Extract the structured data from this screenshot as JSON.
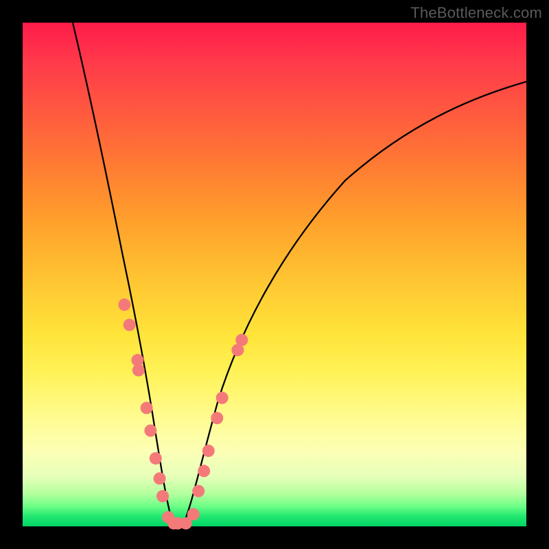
{
  "watermark": "TheBottleneck.com",
  "colors": {
    "frame": "#000000",
    "curve_stroke": "#000000",
    "marker_fill": "#f47a7a",
    "marker_stroke": "#c85a5a"
  },
  "chart_data": {
    "type": "line",
    "title": "",
    "xlabel": "",
    "ylabel": "",
    "xlim": [
      0,
      100
    ],
    "ylim": [
      0,
      100
    ],
    "grid": false,
    "legend": false,
    "curve_left": {
      "comment": "Left descending branch, starts at top-left and drops to the valley floor",
      "x": [
        10.0,
        13.5,
        17.0,
        20.5,
        24.0,
        26.5,
        28.0,
        29.5
      ],
      "y": [
        100.0,
        82.0,
        63.0,
        45.0,
        27.0,
        13.0,
        5.0,
        0.5
      ]
    },
    "curve_right": {
      "comment": "Right ascending branch, rises from valley floor toward upper-right",
      "x": [
        32.5,
        34.0,
        36.5,
        40.0,
        47.0,
        57.0,
        70.0,
        85.0,
        100.0
      ],
      "y": [
        0.5,
        3.0,
        13.0,
        27.0,
        45.0,
        61.0,
        73.0,
        82.0,
        88.0
      ]
    },
    "markers": {
      "comment": "Salmon circular data points overlaid along lower portions of both branches and valley floor",
      "points": [
        {
          "x": 20.2,
          "y": 44.0
        },
        {
          "x": 21.2,
          "y": 40.0
        },
        {
          "x": 22.8,
          "y": 33.0
        },
        {
          "x": 23.0,
          "y": 31.0
        },
        {
          "x": 24.6,
          "y": 23.5
        },
        {
          "x": 25.4,
          "y": 19.0
        },
        {
          "x": 26.4,
          "y": 13.5
        },
        {
          "x": 27.2,
          "y": 9.5
        },
        {
          "x": 27.8,
          "y": 6.0
        },
        {
          "x": 28.9,
          "y": 1.8
        },
        {
          "x": 30.0,
          "y": 0.6
        },
        {
          "x": 30.8,
          "y": 0.6
        },
        {
          "x": 32.4,
          "y": 0.6
        },
        {
          "x": 33.9,
          "y": 2.4
        },
        {
          "x": 34.9,
          "y": 7.0
        },
        {
          "x": 36.0,
          "y": 11.0
        },
        {
          "x": 36.9,
          "y": 15.0
        },
        {
          "x": 38.6,
          "y": 21.5
        },
        {
          "x": 39.6,
          "y": 25.5
        },
        {
          "x": 42.7,
          "y": 35.0
        },
        {
          "x": 43.5,
          "y": 37.0
        }
      ]
    }
  }
}
